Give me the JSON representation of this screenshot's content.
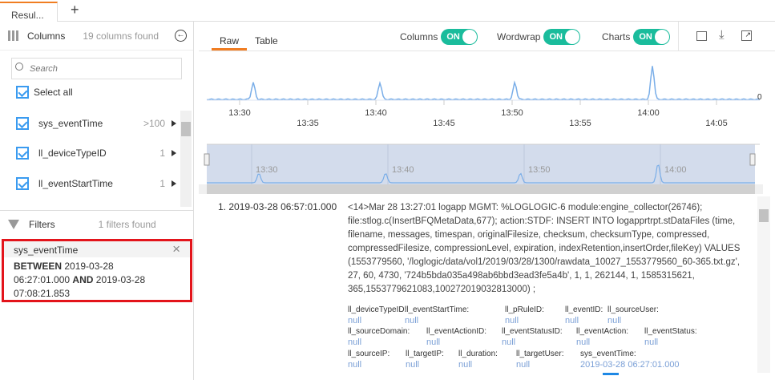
{
  "tabs": {
    "active": "Resul...",
    "add": "+"
  },
  "columns": {
    "title": "Columns",
    "count": "19 columns found",
    "search_placeholder": "Search",
    "select_all": "Select all",
    "items": [
      {
        "name": "sys_eventTime",
        "count": ">100"
      },
      {
        "name": "ll_deviceTypeID",
        "count": "1"
      },
      {
        "name": "ll_eventStartTime",
        "count": "1"
      }
    ]
  },
  "filters": {
    "title": "Filters",
    "count": "1 filters found",
    "items": [
      {
        "field": "sys_eventTime",
        "op1": "BETWEEN",
        "v1": "2019-03-28",
        "v1b": "06:27:01.000",
        "op2": "AND",
        "v2": "2019-03-28",
        "v2b": "07:08:21.853"
      }
    ]
  },
  "toolbar": {
    "tab_raw": "Raw",
    "tab_table": "Table",
    "columns": "Columns",
    "wordwrap": "Wordwrap",
    "charts": "Charts",
    "on": "ON"
  },
  "timeline": {
    "zero_label": "0",
    "ticks_top": [
      "13:30",
      "13:40",
      "13:50",
      "14:00"
    ],
    "ticks_bottom": [
      "13:35",
      "13:45",
      "13:55",
      "14:05"
    ],
    "nav_ticks": [
      "13:30",
      "13:40",
      "13:50",
      "14:00"
    ],
    "peaks": [
      {
        "minute": 31,
        "value": 1
      },
      {
        "minute": 40.3,
        "value": 1
      },
      {
        "minute": 50.2,
        "value": 1
      },
      {
        "minute": 60.3,
        "value": 2
      }
    ]
  },
  "log": {
    "index": "1.",
    "time": "2019-03-28 06:57:01.000",
    "message": "<14>Mar 28 13:27:01 logapp MGMT: %LOGLOGIC-6 module:engine_collector(26746); file:stlog.c(InsertBFQMetaData,677); action:STDF: INSERT INTO logapprtrpt.stDataFiles (time, filename, messages, timespan, originalFilesize, checksum, checksumType, compressed, compressedFilesize, compressionLevel, expiration, indexRetention,insertOrder,fileKey) VALUES (1553779560, '/loglogic/data/vol1/2019/03/28/1300/rawdata_10027_1553779560_60-365.txt.gz', 27, 60, 4730, '724b5bda035a498ab6bbd3ead3fe5a4b', 1, 1, 262144, 1, 1585315621, 365,1553779621083,100272019032813000) ;",
    "fields": [
      {
        "k": "ll_deviceTypeID:",
        "v": "null"
      },
      {
        "k": "ll_eventStartTime:",
        "v": "null"
      },
      {
        "k": "ll_pRuleID:",
        "v": "null"
      },
      {
        "k": "ll_eventID:",
        "v": "null"
      },
      {
        "k": "ll_sourceUser:",
        "v": "null"
      },
      {
        "k": "ll_sourceDomain:",
        "v": "null"
      },
      {
        "k": "ll_eventActionID:",
        "v": "null"
      },
      {
        "k": "ll_eventStatusID:",
        "v": "null"
      },
      {
        "k": "ll_eventAction:",
        "v": "null"
      },
      {
        "k": "ll_eventStatus:",
        "v": "null"
      },
      {
        "k": "ll_sourceIP:",
        "v": "null"
      },
      {
        "k": "ll_targetIP:",
        "v": "null"
      },
      {
        "k": "ll_duration:",
        "v": "null"
      },
      {
        "k": "ll_targetUser:",
        "v": "null"
      },
      {
        "k": "sys_eventTime:",
        "v": "2019-03-28 06:27:01.000"
      }
    ]
  },
  "colors": {
    "accent": "#f07d22",
    "toggle": "#1abc9c",
    "checkbox": "#3a9bf0",
    "filter_border": "#e3141b",
    "line": "#7aaee8"
  }
}
